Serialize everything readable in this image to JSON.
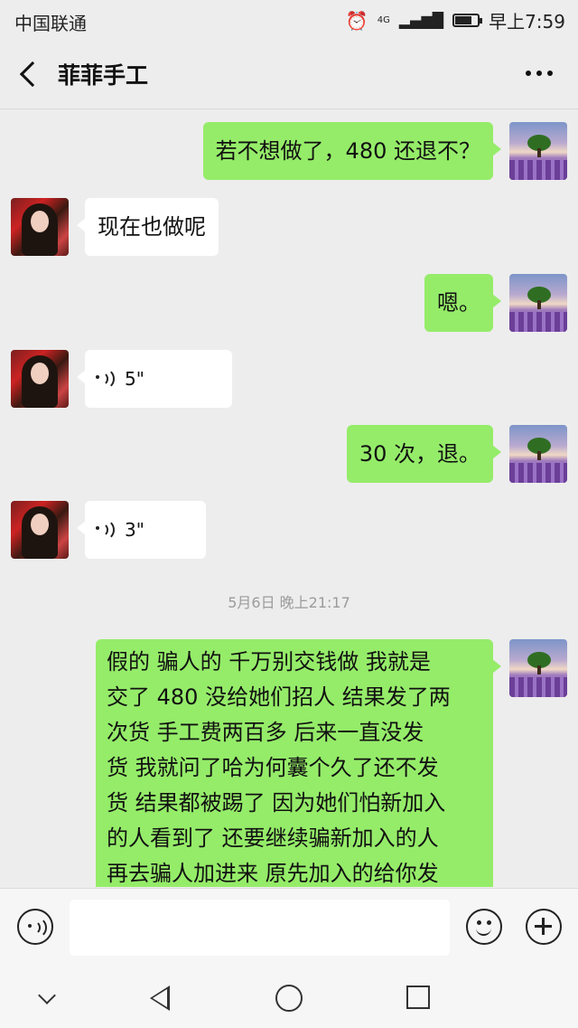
{
  "status": {
    "carrier": "中国联通",
    "network": "4G",
    "time": "早上7:59",
    "battery_level": 0.8
  },
  "header": {
    "title": "菲菲手工"
  },
  "messages": [
    {
      "from": "me",
      "text": "若不想做了，480 还退不？"
    },
    {
      "from": "her",
      "text": "现在也做呢"
    },
    {
      "from": "me",
      "text": "嗯。"
    },
    {
      "from": "her",
      "type": "voice",
      "duration": "5\""
    },
    {
      "from": "me",
      "text": "30 次，退。"
    },
    {
      "from": "her",
      "type": "voice",
      "duration": "3\""
    },
    {
      "from": "me",
      "lines": [
        "假的 骗人的 千万别交钱做 我就是",
        "交了 480 没给她们招人 结果发了两",
        "次货 手工费两百多 后来一直没发",
        "货 我就问了哈为何囊个久了还不发",
        "货 结果都被踢了 因为她们怕新加入",
        "的人看到了 还要继续骗新加入的人",
        "再去骗人加进来 原先加入的给你发"
      ]
    }
  ],
  "timestamp": "5月6日 晚上21:17",
  "input": {
    "placeholder": ""
  },
  "colors": {
    "my_bubble": "#95ec69",
    "their_bubble": "#ffffff",
    "background": "#ededed"
  }
}
